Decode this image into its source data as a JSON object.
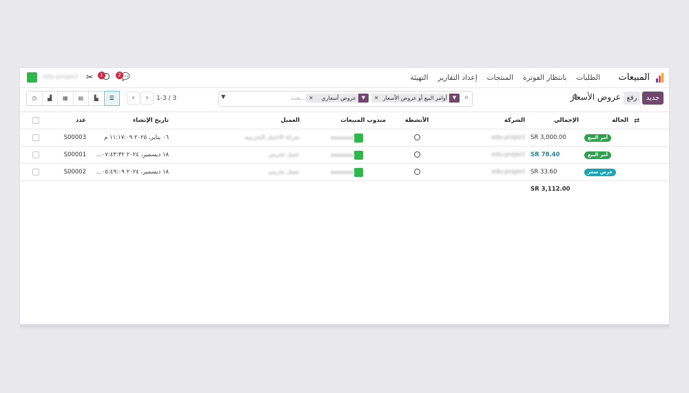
{
  "navbar": {
    "brand": "المبيعات",
    "menu": [
      "الطلبات",
      "بانتظار الفوترة",
      "المنتجات",
      "إعداد التقارير",
      "التهيئة"
    ],
    "company": "edu-project",
    "activity_badge": "1",
    "chat_badge": "2"
  },
  "control": {
    "new_label": "جديد",
    "upload_label": "رفع",
    "title": "عروض الأسعار",
    "facets": [
      {
        "label": "أوامر البيع أو عروض الأسعار"
      },
      {
        "label": "عروض أسعاري"
      }
    ],
    "search_placeholder": "بحث...",
    "pager": "1-3 / 3"
  },
  "colors": {
    "brand_primary": "#71486d",
    "tag_sales_order": "#2d9f4e",
    "tag_quotation": "#1aa5b7",
    "avatar": "#2eb74a"
  },
  "table": {
    "headers": {
      "number": "عدد",
      "created": "تاريخ الإنشاء",
      "customer": "العميل",
      "salesperson": "مندوب المبيعات",
      "activities": "الأنشطة",
      "company": "الشركة",
      "total": "الإجمالي",
      "status": "الحالة"
    },
    "rows": [
      {
        "number": "S00003",
        "created": "٠٦ يناير، ٢٠٢٥ ١١:١٧:٠٩ م",
        "customer": "شركة الاختبار التجريبية",
        "company": "edu-project",
        "total": "3,000.00 SR",
        "status": "أمر البيع"
      },
      {
        "number": "S00001",
        "created": "١٨ ديسمبر، ٢٠٢٤ ٠٧:٤٣:٣٢...",
        "customer": "عميل تجريبي",
        "company": "edu-project",
        "total": "78.40 SR",
        "status": "أمر البيع"
      },
      {
        "number": "S00002",
        "created": "١٨ ديسمبر، ٢٠٢٤ ٠٥:٤٩:٠٩...",
        "customer": "عميل تجريبي",
        "company": "edu-project",
        "total": "33.60 SR",
        "status": "عرض سعر"
      }
    ],
    "footer_total": "3,112.00 SR"
  }
}
